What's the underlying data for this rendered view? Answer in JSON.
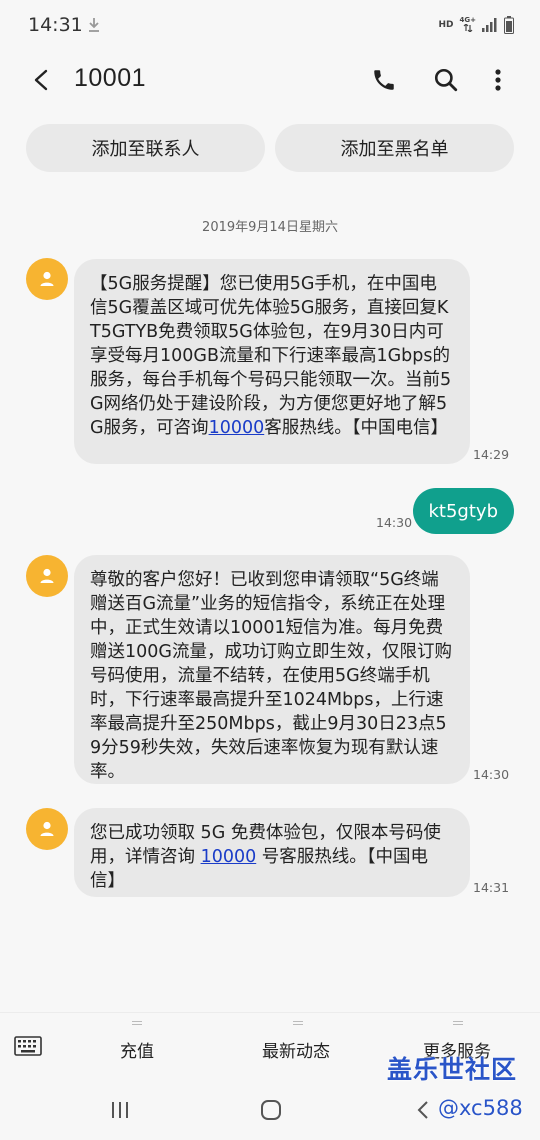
{
  "status_bar": {
    "time": "14:31",
    "hd": "HD",
    "network": "4G+"
  },
  "header": {
    "title": "10001",
    "icons": [
      "back-arrow-icon",
      "phone-icon",
      "search-icon",
      "more-vert-icon"
    ]
  },
  "actions": {
    "add_contact": "添加至联系人",
    "add_blacklist": "添加至黑名单"
  },
  "conversation": {
    "date": "2019年9月14日星期六",
    "messages": [
      {
        "direction": "incoming",
        "text_before_link": "【5G服务提醒】您已使用5G手机，在中国电信5G覆盖区域可优先体验5G服务，直接回复KT5GTYB免费领取5G体验包，在9月30日内可享受每月100GB流量和下行速率最高1Gbps的服务，每台手机每个号码只能领取一次。当前5G网络仍处于建设阶段，为方便您更好地了解5G服务，可咨询",
        "link": "10000",
        "text_after_link": "客服热线。【中国电信】",
        "time": "14:29"
      },
      {
        "direction": "outgoing",
        "text": "kt5gtyb",
        "time": "14:30"
      },
      {
        "direction": "incoming",
        "text": "尊敬的客户您好！已收到您申请领取“5G终端赠送百G流量”业务的短信指令，系统正在处理中，正式生效请以10001短信为准。每月免费赠送100G流量，成功订购立即生效，仅限订购号码使用，流量不结转，在使用5G终端手机时，下行速率最高提升至1024Mbps，上行速率最高提升至250Mbps，截止9月30日23点59分59秒失效，失效后速率恢复为现有默认速率。",
        "time": "14:30"
      },
      {
        "direction": "incoming",
        "text_before_link": "您已成功领取 5G 免费体验包，仅限本号码使用，详情咨询 ",
        "link": "10000",
        "text_after_link": " 号客服热线。【中国电信】",
        "time": "14:31"
      }
    ]
  },
  "bottom_menu": {
    "items": [
      "充值",
      "最新动态",
      "更多服务"
    ]
  },
  "watermark": {
    "title": "盖乐世社区",
    "user": "@xc588"
  },
  "colors": {
    "avatar": "#f7b431",
    "outgoing_bubble": "#10a08d",
    "incoming_bubble": "#e8e8e8",
    "link": "#1a3cc8",
    "watermark": "#2a55c8"
  }
}
